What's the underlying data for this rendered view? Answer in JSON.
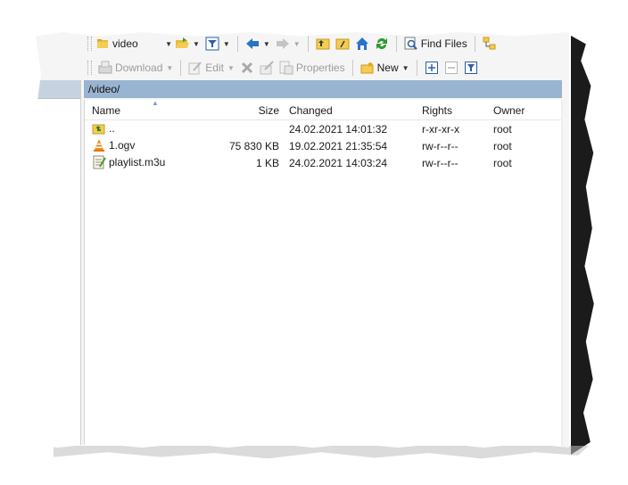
{
  "toolbar1": {
    "location": "video",
    "find_files": "Find Files",
    "icons": [
      "folder-open-icon",
      "filter-icon",
      "back-arrow-icon",
      "forward-arrow-icon",
      "parent-folder-icon",
      "root-folder-icon",
      "home-icon",
      "refresh-icon",
      "find-icon",
      "tree-icon"
    ]
  },
  "toolbar2": {
    "download": "Download",
    "edit": "Edit",
    "properties": "Properties",
    "new": "New"
  },
  "path": "/video/",
  "columns": {
    "name": "Name",
    "size": "Size",
    "changed": "Changed",
    "rights": "Rights",
    "owner": "Owner"
  },
  "files": [
    {
      "name": "..",
      "size": "",
      "changed": "24.02.2021 14:01:32",
      "rights": "r-xr-xr-x",
      "owner": "root",
      "icon": "parent-dir-icon"
    },
    {
      "name": "1.ogv",
      "size": "75 830 KB",
      "changed": "19.02.2021 21:35:54",
      "rights": "rw-r--r--",
      "owner": "root",
      "icon": "vlc-cone-icon"
    },
    {
      "name": "playlist.m3u",
      "size": "1 KB",
      "changed": "24.02.2021 14:03:24",
      "rights": "rw-r--r--",
      "owner": "root",
      "icon": "playlist-file-icon"
    }
  ],
  "colors": {
    "path_bar": "#99b4d1",
    "window_bg": "#f5f5f5",
    "list_bg": "#ffffff"
  }
}
